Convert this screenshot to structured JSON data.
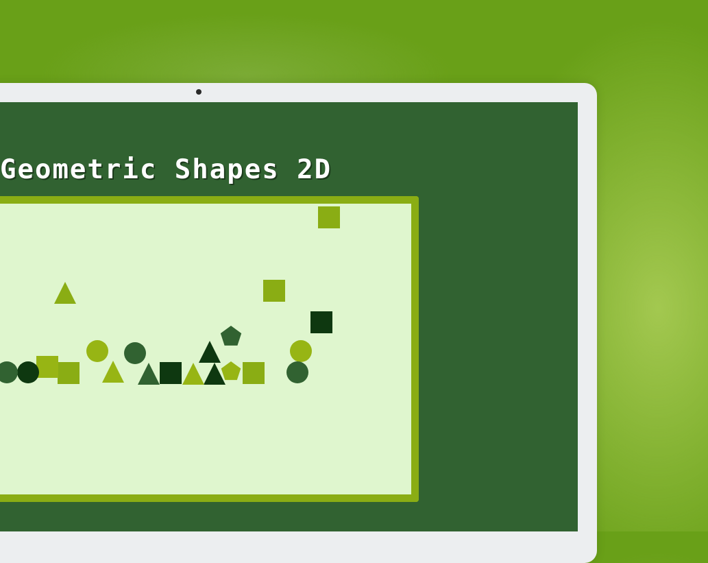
{
  "game": {
    "title": "Geometric Shapes 2D"
  },
  "colors": {
    "background": "#69a018",
    "laptop_bezel": "#eceef0",
    "screen": "#316231",
    "canvas_border": "#8aad14",
    "canvas_fill": "#dff6ce",
    "shape_palette": [
      "#8aad14",
      "#316231",
      "#0e3810",
      "#97b514"
    ]
  },
  "shapes": [
    {
      "type": "square",
      "color": "#8aad14",
      "name": "falling-square-top"
    },
    {
      "type": "circle",
      "color": "#8aad14",
      "name": "falling-circle-left"
    },
    {
      "type": "triangle",
      "color": "#8aad14",
      "name": "falling-triangle"
    },
    {
      "type": "square",
      "color": "#8aad14",
      "name": "stacked-square-right"
    },
    {
      "type": "square",
      "color": "#0e3810",
      "name": "dark-square-right"
    },
    {
      "type": "pentagon",
      "color": "#316231",
      "name": "pentagon-upper"
    },
    {
      "type": "circle",
      "color": "#97b514",
      "name": "circle-right"
    },
    {
      "type": "circle",
      "color": "#316231",
      "name": "circle-bottom-right"
    },
    {
      "type": "square",
      "color": "#8aad14",
      "name": "ground-square-right"
    },
    {
      "type": "pentagon",
      "color": "#97b514",
      "name": "pentagon-ground"
    },
    {
      "type": "triangle",
      "color": "#0e3810",
      "name": "triangle-upper-dark"
    },
    {
      "type": "triangle",
      "color": "#0e3810",
      "name": "triangle-ground-dark"
    },
    {
      "type": "triangle",
      "color": "#97b514",
      "name": "triangle-ground-light"
    },
    {
      "type": "square",
      "color": "#0e3810",
      "name": "ground-square-dark"
    },
    {
      "type": "triangle",
      "color": "#316231",
      "name": "triangle-ground-mid"
    },
    {
      "type": "triangle",
      "color": "#97b514",
      "name": "triangle-ground-left"
    },
    {
      "type": "circle",
      "color": "#316231",
      "name": "circle-mid"
    },
    {
      "type": "circle",
      "color": "#97b514",
      "name": "circle-light-left"
    },
    {
      "type": "square",
      "color": "#8aad14",
      "name": "ground-square-left"
    },
    {
      "type": "square",
      "color": "#97b514",
      "name": "stacked-square-left"
    },
    {
      "type": "circle",
      "color": "#0e3810",
      "name": "circle-dark-ground"
    },
    {
      "type": "circle",
      "color": "#316231",
      "name": "circle-edge-ground"
    }
  ]
}
